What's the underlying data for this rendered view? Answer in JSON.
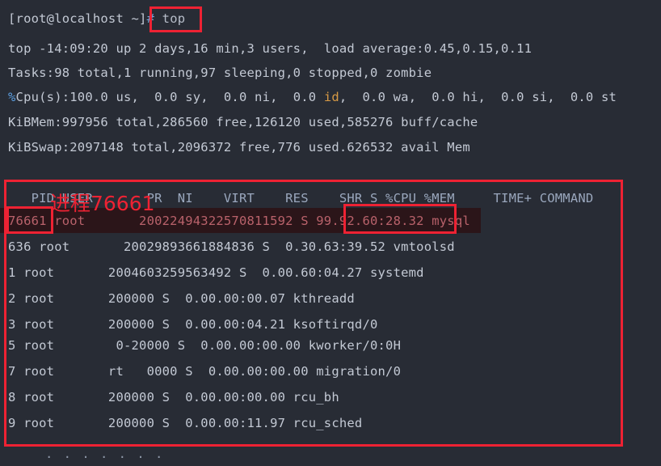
{
  "terminal": {
    "background": "#282c35",
    "foreground": "#c3c9d4",
    "accent_red": "#ee2233",
    "highlight_row_bg": "#2b1519",
    "prompt_line": {
      "prompt": "[root@localhost ~]",
      "hash": "#",
      "command": " top"
    },
    "summary": {
      "uptime_line": "top -14:09:20 up 2 days,16 min,3 users,  load average:0.45,0.15,0.11",
      "tasks_line": "Tasks:98 total,1 running,97 sleeping,0 stopped,0 zombie",
      "cpu_percent_symbol": "%",
      "cpu_line_a": "Cpu(s):100.0 us,  0.0 sy,  0.0 ni,  0.0 ",
      "cpu_line_idle": "id",
      "cpu_line_b": ",  0.0 wa,  0.0 hi,  0.0 si,  0.0 st",
      "mem_line": "KiBMem:997956 total,286560 free,126120 used,585276 buff/cache",
      "swap_line": "KiBSwap:2097148 total,2096372 free,776 used.626532 avail Mem"
    },
    "table": {
      "header": "   PID USER       PR  NI    VIRT    RES    SHR S %CPU %MEM     TIME+ COMMAND",
      "rows": [
        {
          "text": "76661 root       20022494322570811592 S 99.92.60:28.32 mysql",
          "highlighted": true
        },
        {
          "text": "636 root       20029893661884836 S  0.30.63:39.52 vmtoolsd",
          "highlighted": false
        },
        {
          "text": "1 root       2004603259563492 S  0.00.60:04.27 systemd",
          "highlighted": false
        },
        {
          "text": "2 root       200000 S  0.00.00:00.07 kthreadd",
          "highlighted": false
        },
        {
          "text": "3 root       200000 S  0.00.00:04.21 ksoftirqd/0",
          "highlighted": false
        },
        {
          "text": "5 root        0-20000 S  0.00.00:00.00 kworker/0:0H",
          "highlighted": false
        },
        {
          "text": "7 root       rt   0000 S  0.00.00:00.00 migration/0",
          "highlighted": false
        },
        {
          "text": "8 root       200000 S  0.00.00:00.00 rcu_bh",
          "highlighted": false
        },
        {
          "text": "9 root       200000 S  0.00.00:11.97 rcu_sched",
          "highlighted": false
        }
      ],
      "truncation_dots": ". . . . . . ."
    },
    "annotations": {
      "process_label": "进程76661",
      "boxed_command": "# top",
      "boxed_pid": "76661",
      "boxed_cpu_time": "99.92.60:28.32"
    }
  }
}
